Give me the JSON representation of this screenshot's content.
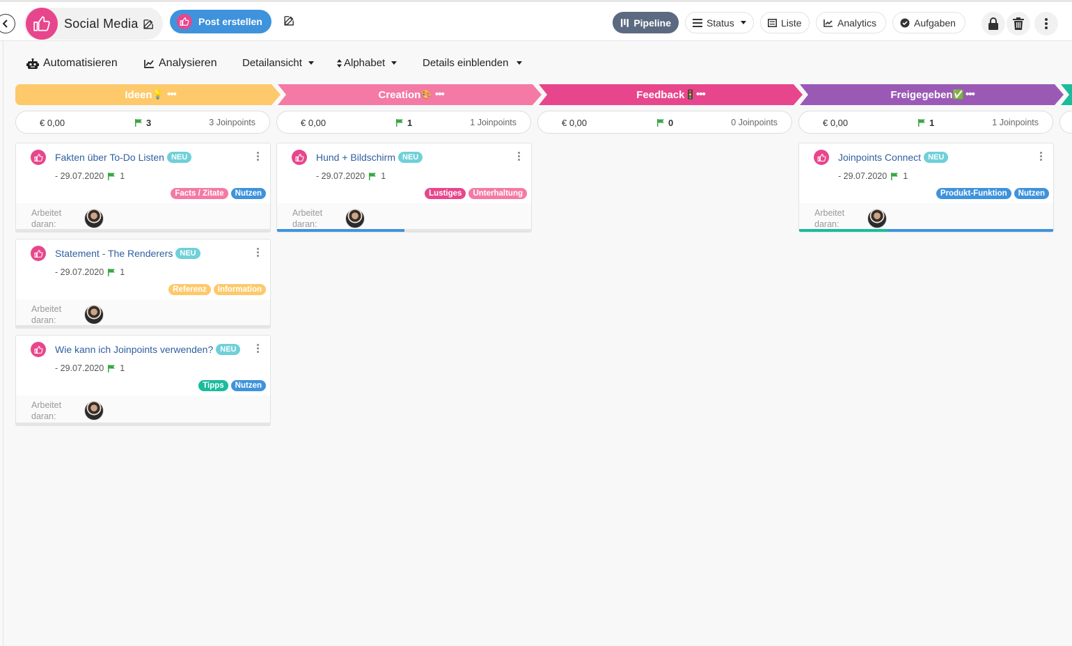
{
  "header": {
    "board_title": "Social Media",
    "post_button": "Post erstellen",
    "views": [
      {
        "label": "Pipeline",
        "active": true,
        "icon": "pipeline-icon"
      },
      {
        "label": "Status",
        "active": false,
        "icon": "list-lines-icon"
      },
      {
        "label": "Liste",
        "active": false,
        "icon": "table-icon"
      },
      {
        "label": "Analytics",
        "active": false,
        "icon": "chart-line-icon"
      },
      {
        "label": "Aufgaben",
        "active": false,
        "icon": "check-circle-icon"
      }
    ]
  },
  "toolbar": {
    "automate": "Automatisieren",
    "analyze": "Analysieren",
    "detail_view": "Detailansicht",
    "sort": "Alphabet",
    "show_details": "Details einblenden"
  },
  "colors": {
    "brand_pink": "#e8468c",
    "primary_blue": "#3f93dc",
    "stage_ideen": "#fdc96b",
    "stage_creation": "#f47aa5",
    "stage_feedback": "#e8468c",
    "stage_freigegeben": "#9b59b6",
    "stage_next": "#1abc9c"
  },
  "stages": [
    {
      "name": "Ideen",
      "emoji": "💡",
      "money": "€ 0,00",
      "count": "3",
      "joinpoints": "3 Joinpoints"
    },
    {
      "name": "Creation",
      "emoji": "🎨",
      "money": "€ 0,00",
      "count": "1",
      "joinpoints": "1 Joinpoints"
    },
    {
      "name": "Feedback",
      "emoji": "🚦",
      "money": "€ 0,00",
      "count": "0",
      "joinpoints": "0 Joinpoints"
    },
    {
      "name": "Freigegeben",
      "emoji": "✅",
      "money": "€ 0,00",
      "count": "1",
      "joinpoints": "1 Joinpoints"
    }
  ],
  "card_common": {
    "badge": "NEU",
    "working_label_1": "Arbeitet",
    "working_label_2": "daran:"
  },
  "cards": [
    {
      "title": "Fakten über To-Do Listen",
      "date": "- 29.07.2020",
      "count": "1",
      "tags": [
        "Facts / Zitate",
        "Nutzen"
      ],
      "progress": 0.0
    },
    {
      "title": "Statement - The Renderers",
      "date": "- 29.07.2020",
      "count": "1",
      "tags": [
        "Referenz",
        "Information"
      ],
      "progress": 0.0
    },
    {
      "title": "Wie kann ich Joinpoints verwenden?",
      "date": "- 29.07.2020",
      "count": "1",
      "tags": [
        "Tipps",
        "Nutzen"
      ],
      "progress": 0.0
    },
    {
      "title": "Hund + Bildschirm",
      "date": "- 29.07.2020",
      "count": "1",
      "tags": [
        "Lustiges",
        "Unterhaltung"
      ],
      "progress": 0.5
    },
    {
      "title": "Joinpoints Connect",
      "date": "- 29.07.2020",
      "count": "1",
      "tags": [
        "Produkt-Funktion",
        "Nutzen"
      ],
      "progress": 1.0
    }
  ]
}
